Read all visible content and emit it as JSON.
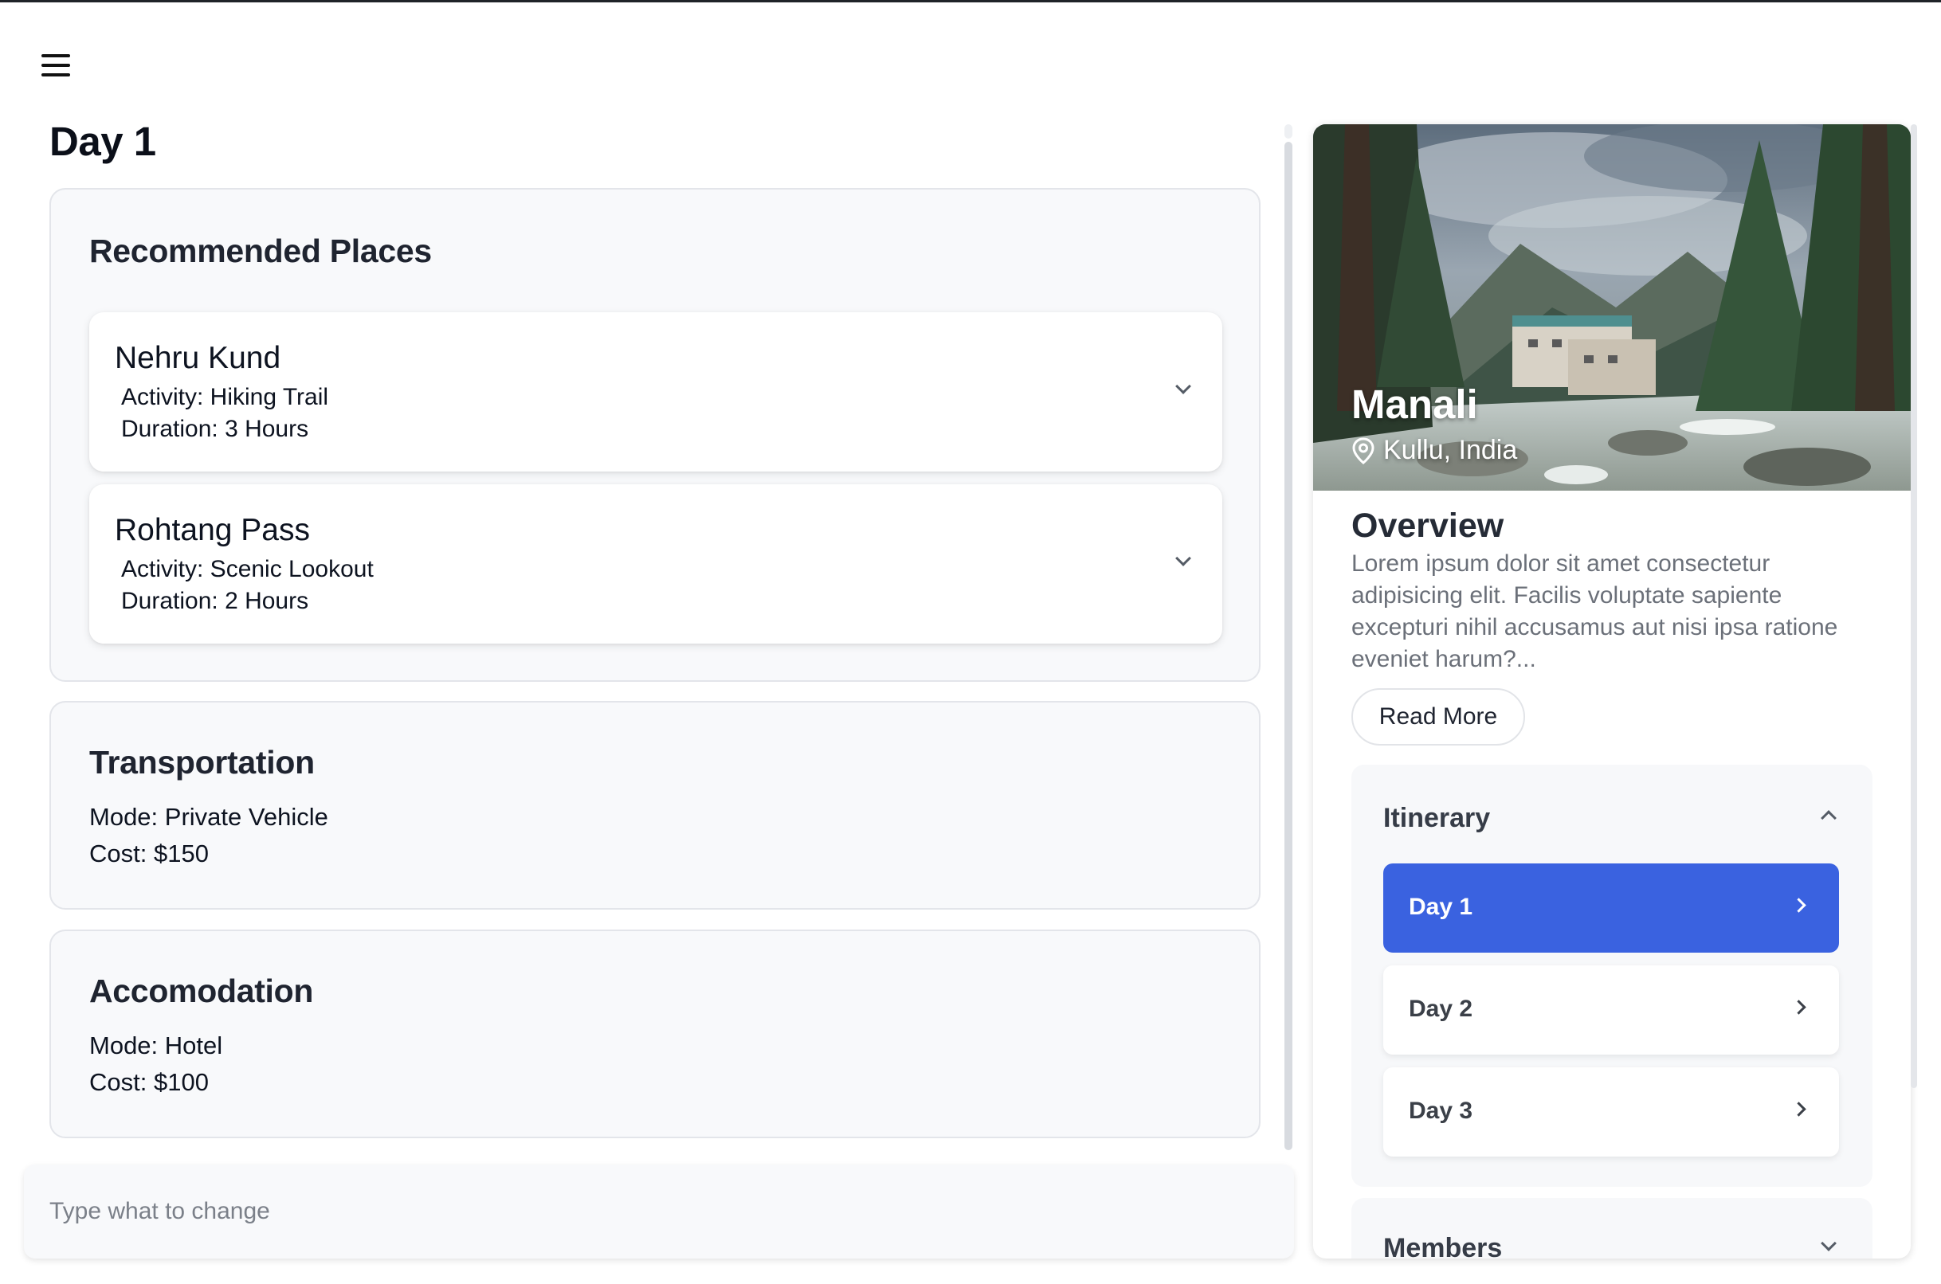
{
  "header": {
    "menu_icon": "hamburger-menu-icon"
  },
  "main": {
    "day_title": "Day 1",
    "recommended": {
      "title": "Recommended Places",
      "places": [
        {
          "name": "Nehru Kund",
          "activity": "Activity: Hiking Trail",
          "duration": "Duration: 3 Hours"
        },
        {
          "name": "Rohtang Pass",
          "activity": "Activity: Scenic Lookout",
          "duration": "Duration: 2 Hours"
        }
      ]
    },
    "transportation": {
      "title": "Transportation",
      "mode": "Mode: Private Vehicle",
      "cost": "Cost: $150"
    },
    "accommodation": {
      "title": "Accomodation",
      "mode": "Mode: Hotel",
      "cost": "Cost: $100"
    },
    "chat": {
      "placeholder": "Type what to change",
      "value": ""
    }
  },
  "side": {
    "destination": {
      "name": "Manali",
      "location": "Kullu, India",
      "location_icon": "map-pin-icon"
    },
    "overview": {
      "title": "Overview",
      "text": "Lorem ipsum dolor sit amet consectetur adipisicing elit. Facilis voluptate sapiente excepturi nihil accusamus aut nisi ipsa ratione eveniet harum?...",
      "read_more": "Read More"
    },
    "itinerary": {
      "title": "Itinerary",
      "expanded": true,
      "days": [
        {
          "label": "Day 1",
          "active": true
        },
        {
          "label": "Day 2",
          "active": false
        },
        {
          "label": "Day 3",
          "active": false
        }
      ]
    },
    "members": {
      "title": "Members",
      "expanded": false
    }
  },
  "colors": {
    "accent": "#3a62e0",
    "card_bg": "#f8f9fb",
    "text": "#0d1320",
    "muted": "#6b7079"
  }
}
